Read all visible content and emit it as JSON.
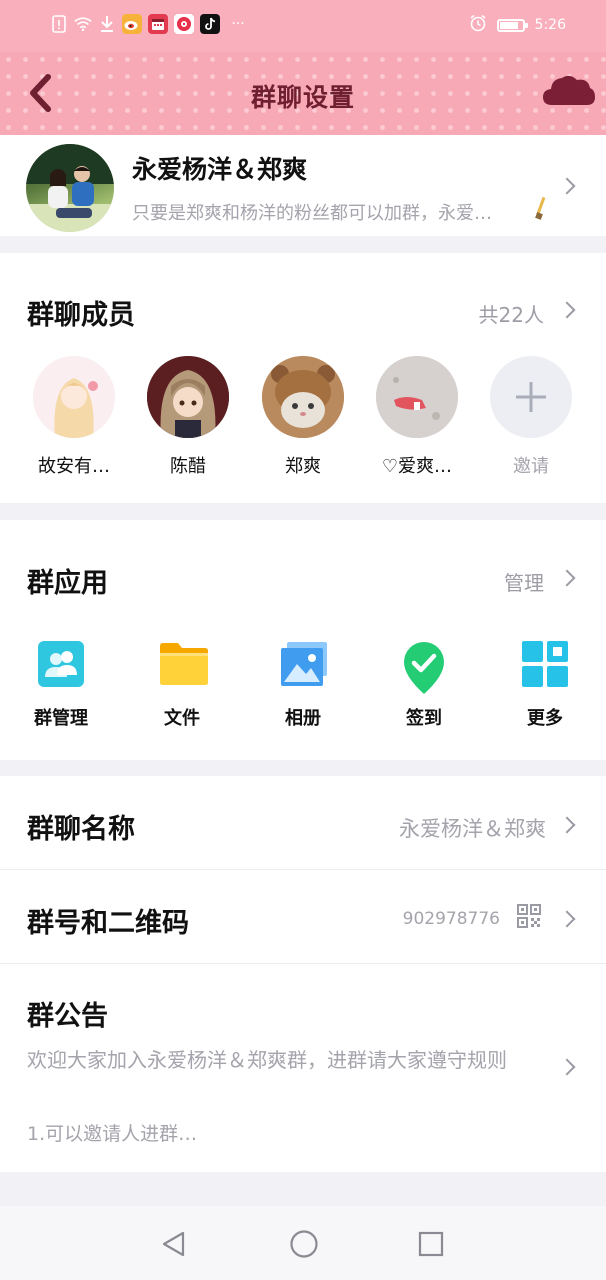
{
  "status_bar": {
    "time": "5:26",
    "left_icons": [
      "sim-alert-icon",
      "wifi-icon",
      "download-icon",
      "weibo-icon",
      "calendar-app-icon",
      "music-app-icon",
      "tiktok-icon"
    ],
    "more": "···"
  },
  "header": {
    "title": "群聊设置"
  },
  "group": {
    "name": "永爱杨洋＆郑爽",
    "description": "只要是郑爽和杨洋的粉丝都可以加群，永爱…"
  },
  "members": {
    "title": "群聊成员",
    "count_label": "共22人",
    "list": [
      {
        "name": "故安有…"
      },
      {
        "name": "陈醋"
      },
      {
        "name": "郑爽"
      },
      {
        "name": "♡爱爽…"
      }
    ],
    "invite_label": "邀请"
  },
  "apps": {
    "title": "群应用",
    "manage_label": "管理",
    "items": [
      {
        "label": "群管理",
        "icon": "group-manage-icon",
        "color": "#2fc6e0"
      },
      {
        "label": "文件",
        "icon": "folder-icon",
        "color": "#ffc81e"
      },
      {
        "label": "相册",
        "icon": "photo-album-icon",
        "color": "#4aa6f2"
      },
      {
        "label": "签到",
        "icon": "checkin-icon",
        "color": "#2bd07a"
      },
      {
        "label": "更多",
        "icon": "more-grid-icon",
        "color": "#27c2e8"
      }
    ]
  },
  "settings": {
    "group_name_label": "群聊名称",
    "group_name_value": "永爱杨洋＆郑爽",
    "group_id_label": "群号和二维码",
    "group_id_value": "902978776",
    "notice_label": "群公告",
    "notice_text": "欢迎大家加入永爱杨洋＆郑爽群，进群请大家遵守规则",
    "notice_text_2": "1.可以邀请人进群…"
  },
  "colors": {
    "header_pink": "#f8a9b6",
    "title_maroon": "#6e1f30",
    "muted_text": "#a4a4ac"
  }
}
